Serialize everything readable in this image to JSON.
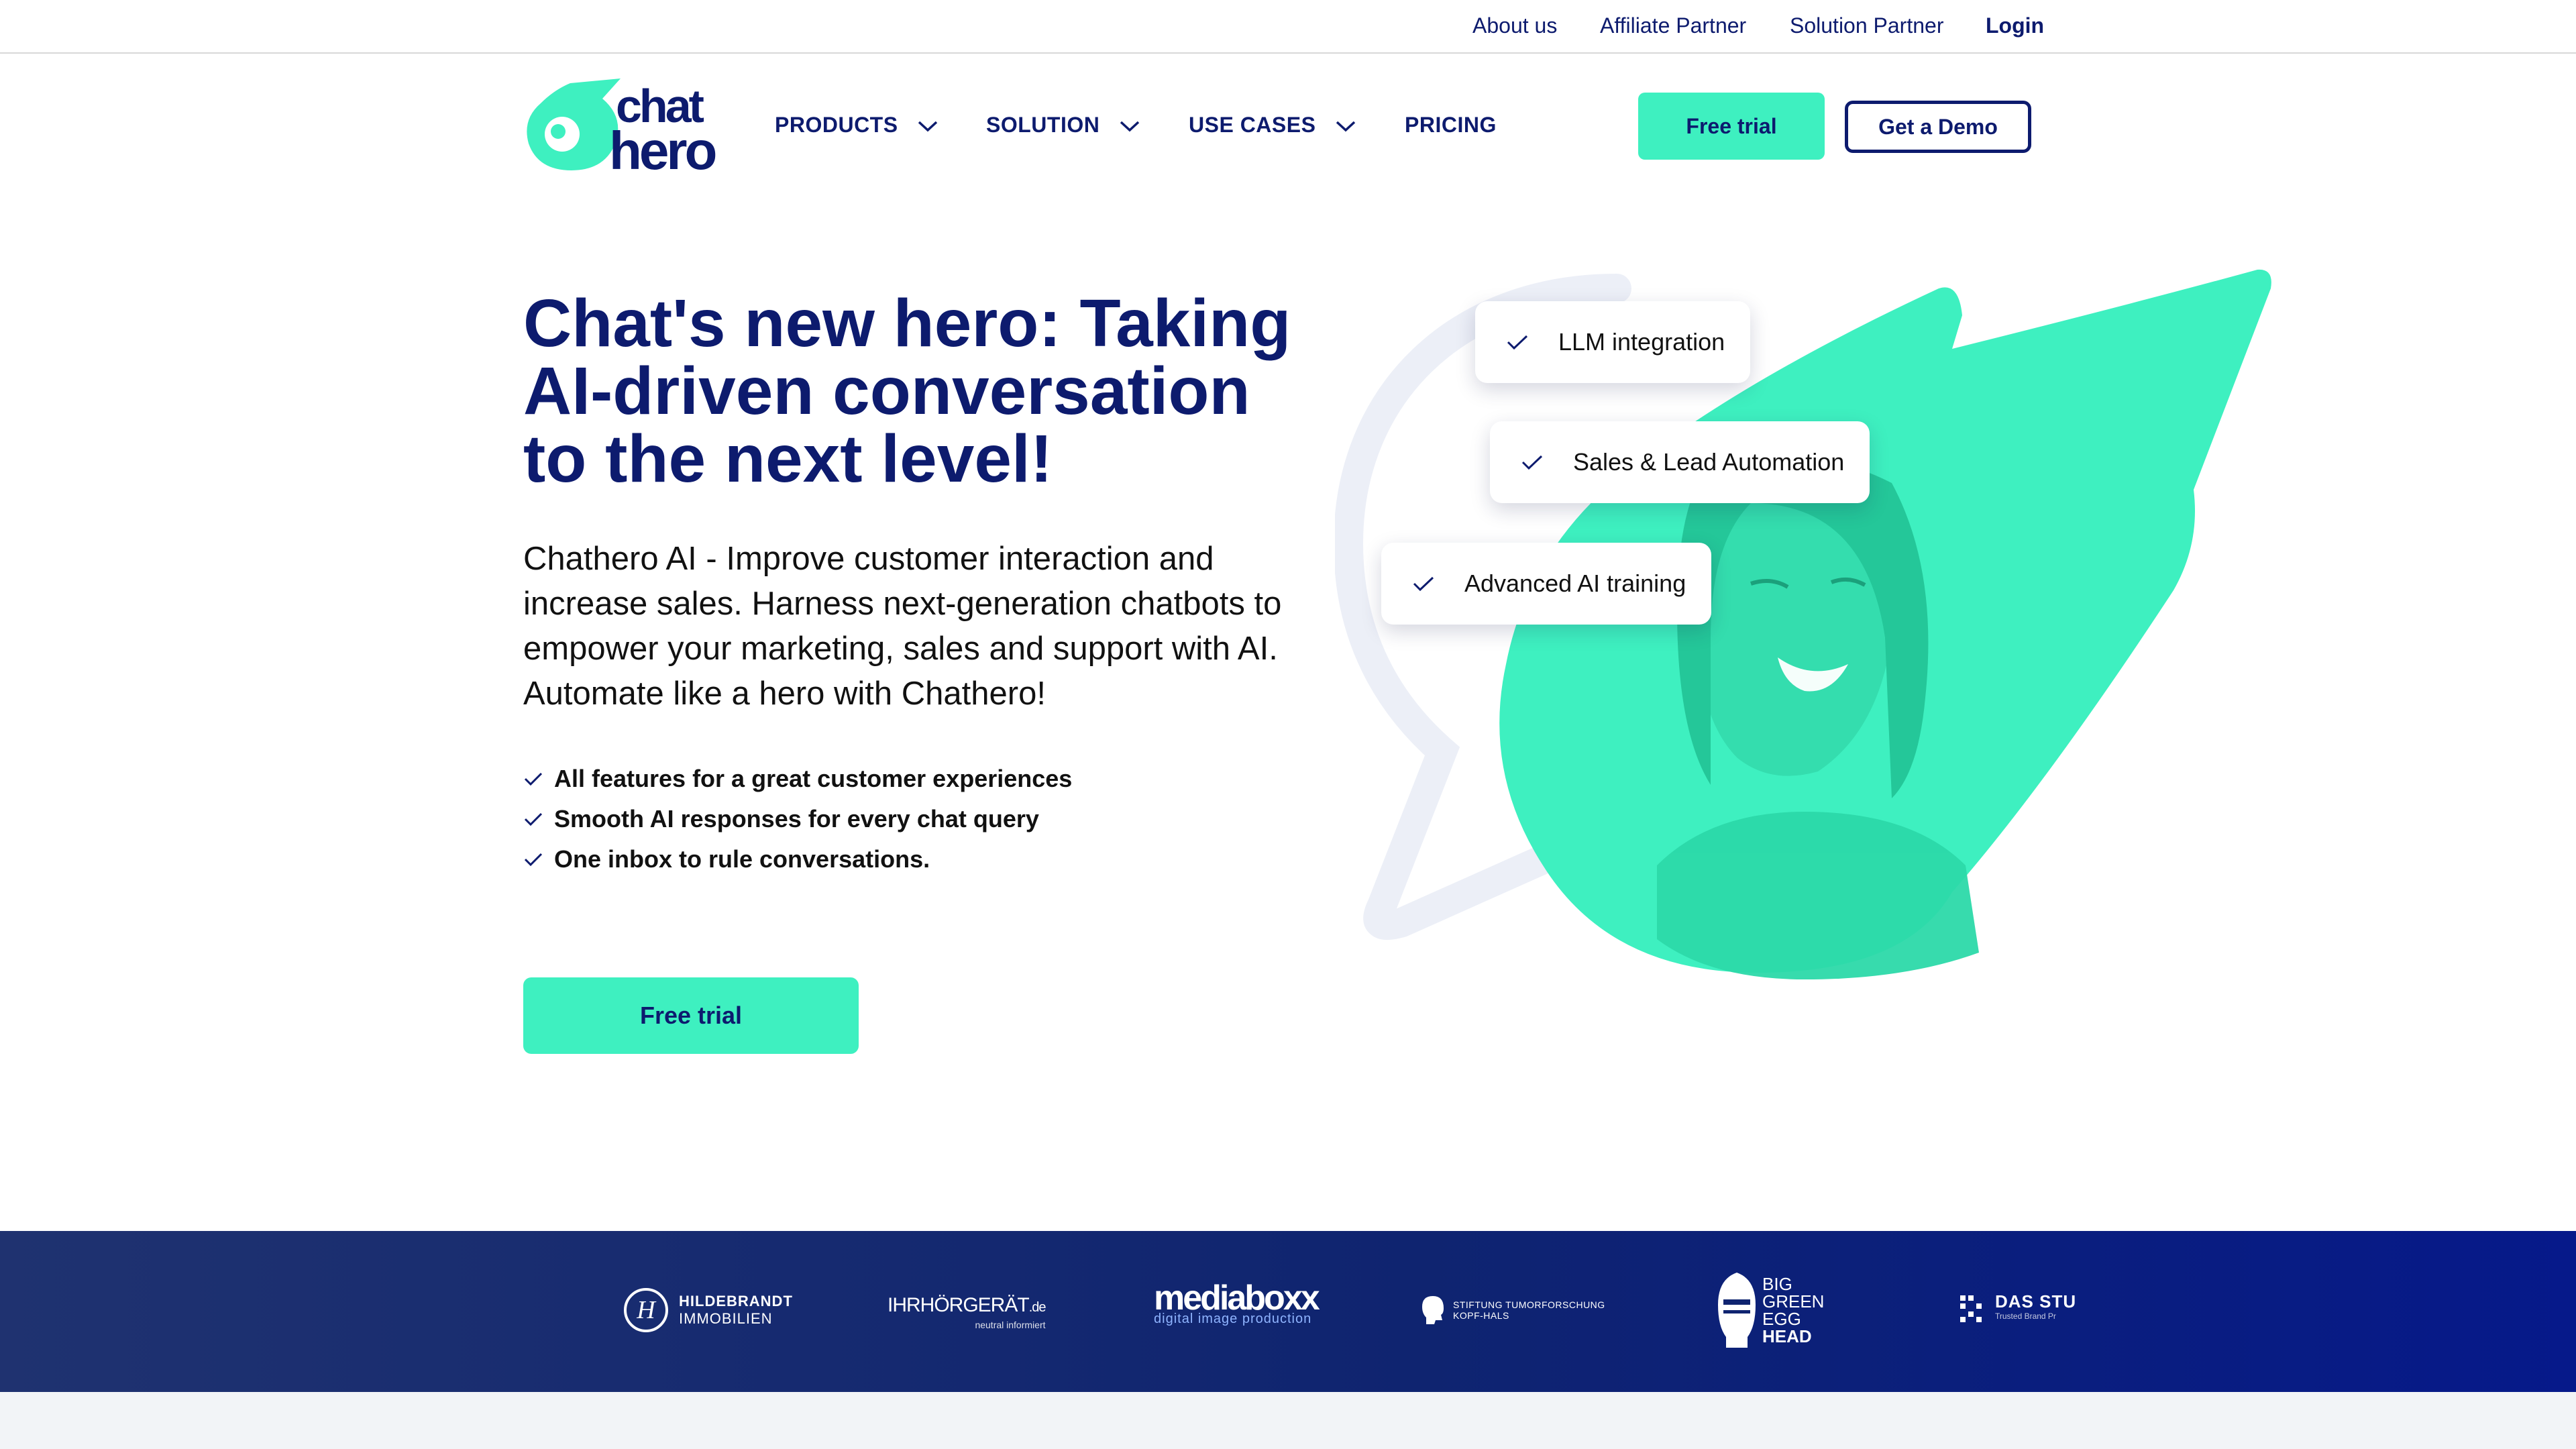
{
  "topbar": {
    "about": "About us",
    "affiliate": "Affiliate Partner",
    "solution_partner": "Solution Partner",
    "login": "Login"
  },
  "brand": {
    "line1": "chat",
    "line2": "hero",
    "accent": "#3ef0c0",
    "navy": "#0d1b6e"
  },
  "nav": {
    "products": "PRODUCTS",
    "solution": "SOLUTION",
    "use_cases": "USE CASES",
    "pricing": "PRICING",
    "free_trial": "Free trial",
    "get_demo": "Get a Demo"
  },
  "hero": {
    "title_line1": "Chat's new hero: Taking",
    "title_line2": "AI-driven conversation",
    "title_line3": "to the next level!",
    "desc_line1": "Chathero AI - Improve customer interaction and",
    "desc_line2": "increase sales. Harness next-generation chatbots to",
    "desc_line3": "empower your marketing, sales and support with AI.",
    "desc_line4": "Automate like a hero with Chathero!",
    "features": [
      "All features for a great customer experiences",
      "Smooth AI responses for every chat query",
      "One inbox to rule conversations."
    ],
    "cta": "Free trial",
    "chips": [
      "LLM integration",
      "Sales & Lead Automation",
      "Advanced AI training"
    ]
  },
  "partners": {
    "hildebrandt_1": "HILDEBRANDT",
    "hildebrandt_2": "IMMOBILIEN",
    "hoergeraet": "IHRHÖRGERÄT",
    "hoergeraet_suffix": ".de",
    "hoergeraet_sub": "neutral informiert",
    "mediaboxx": "mediaboxx",
    "mediaboxx_sub": "digital image production",
    "stiftung_1": "STIFTUNG TUMORFORSCHUNG",
    "stiftung_2": "KOPF-HALS",
    "bge_1": "BIG",
    "bge_2": "GREEN",
    "bge_3": "EGG",
    "bge_4": "HEAD",
    "dasstu": "DAS STU",
    "dasstu_sub": "Trusted Brand Pr"
  }
}
